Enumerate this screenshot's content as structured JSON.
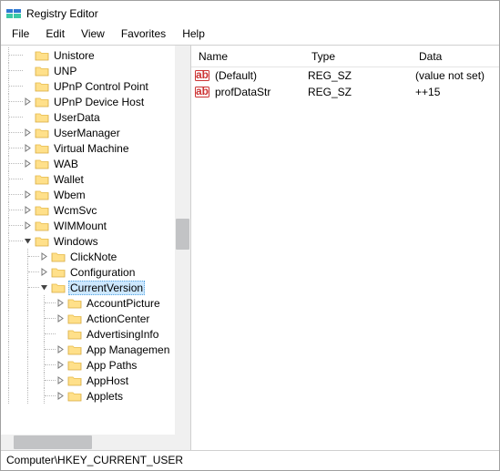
{
  "window": {
    "title": "Registry Editor"
  },
  "menu": {
    "file": "File",
    "edit": "Edit",
    "view": "View",
    "favorites": "Favorites",
    "help": "Help"
  },
  "tree": {
    "items": [
      {
        "indent": 30,
        "twisty": "none",
        "label": "Unistore"
      },
      {
        "indent": 30,
        "twisty": "none",
        "label": "UNP"
      },
      {
        "indent": 30,
        "twisty": "none",
        "label": "UPnP Control Point"
      },
      {
        "indent": 30,
        "twisty": "closed",
        "label": "UPnP Device Host"
      },
      {
        "indent": 30,
        "twisty": "none",
        "label": "UserData"
      },
      {
        "indent": 30,
        "twisty": "closed",
        "label": "UserManager"
      },
      {
        "indent": 30,
        "twisty": "closed",
        "label": "Virtual Machine"
      },
      {
        "indent": 30,
        "twisty": "closed",
        "label": "WAB"
      },
      {
        "indent": 30,
        "twisty": "none",
        "label": "Wallet"
      },
      {
        "indent": 30,
        "twisty": "closed",
        "label": "Wbem"
      },
      {
        "indent": 30,
        "twisty": "closed",
        "label": "WcmSvc"
      },
      {
        "indent": 30,
        "twisty": "closed",
        "label": "WIMMount"
      },
      {
        "indent": 30,
        "twisty": "open",
        "label": "Windows"
      },
      {
        "indent": 49,
        "twisty": "closed",
        "label": "ClickNote"
      },
      {
        "indent": 49,
        "twisty": "closed",
        "label": "Configuration"
      },
      {
        "indent": 49,
        "twisty": "open",
        "label": "CurrentVersion",
        "selected": true
      },
      {
        "indent": 68,
        "twisty": "closed",
        "label": "AccountPicture"
      },
      {
        "indent": 68,
        "twisty": "closed",
        "label": "ActionCenter"
      },
      {
        "indent": 68,
        "twisty": "none",
        "label": "AdvertisingInfo"
      },
      {
        "indent": 68,
        "twisty": "closed",
        "label": "App Managemen"
      },
      {
        "indent": 68,
        "twisty": "closed",
        "label": "App Paths"
      },
      {
        "indent": 68,
        "twisty": "closed",
        "label": "AppHost"
      },
      {
        "indent": 68,
        "twisty": "closed",
        "label": "Applets"
      }
    ]
  },
  "list": {
    "columns": {
      "name": "Name",
      "type": "Type",
      "data": "Data"
    },
    "colwidths": {
      "name": 124,
      "type": 118,
      "data": 96
    },
    "rows": [
      {
        "name": "(Default)",
        "type": "REG_SZ",
        "data": "(value not set)"
      },
      {
        "name": "profDataStr",
        "type": "REG_SZ",
        "data": "++15"
      }
    ]
  },
  "statusbar": {
    "path": "Computer\\HKEY_CURRENT_USER"
  }
}
